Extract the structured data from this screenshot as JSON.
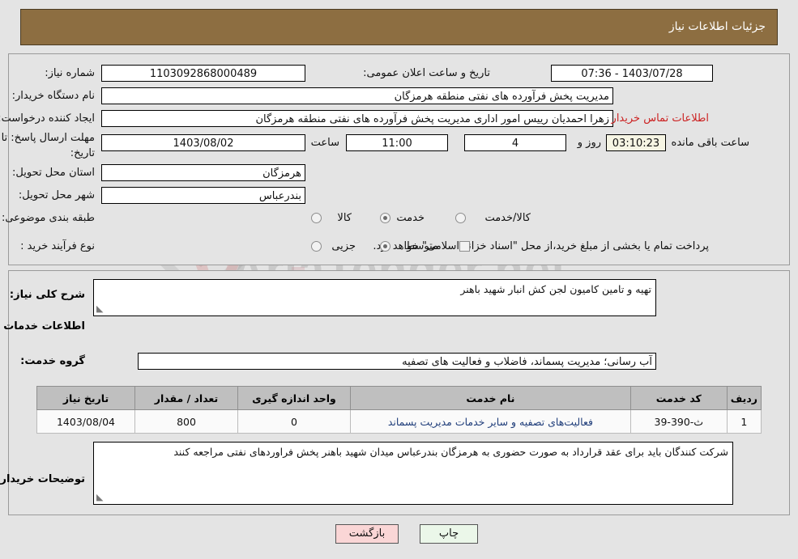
{
  "header": {
    "title": "جزئیات اطلاعات نیاز"
  },
  "watermark": {
    "text": "AriaTender.net",
    "letter": "V"
  },
  "top_form": {
    "need_number_label": "شماره نیاز:",
    "need_number_value": "1103092868000489",
    "buyer_org_label": "نام دستگاه خریدار:",
    "buyer_org_value": "مدیریت پخش فرآورده های نفتی منطقه هرمزگان",
    "creator_label": "ایجاد کننده درخواست:",
    "creator_value": "زهرا احمدیان رییس امور اداری مدیریت پخش فرآورده های نفتی منطقه هرمزگان",
    "buyer_contact_link": "اطلاعات تماس خریدار",
    "public_announce_label": "تاریخ و ساعت اعلان عمومی:",
    "public_announce_value": "1403/07/28 - 07:36",
    "deadline_label_line1": "مهلت ارسال پاسخ: تا",
    "deadline_label_line2": "تاریخ:",
    "deadline_date_value": "1403/08/02",
    "deadline_hour_label": "ساعت",
    "deadline_hour_value": "11:00",
    "remaining_days_value": "4",
    "remaining_days_label": "روز و",
    "remaining_time_value": "03:10:23",
    "remaining_time_label": "ساعت باقی مانده",
    "province_label": "استان محل تحویل:",
    "province_value": "هرمزگان",
    "city_label": "شهر محل تحویل:",
    "city_value": "بندرعباس",
    "category_label": "طبقه بندی موضوعی:",
    "category_options": [
      {
        "label": "کالا",
        "selected": false
      },
      {
        "label": "خدمت",
        "selected": true
      },
      {
        "label": "کالا/خدمت",
        "selected": false
      }
    ],
    "process_label": "نوع فرآیند خرید :",
    "process_options": [
      {
        "label": "جزیی",
        "selected": false
      },
      {
        "label": "متوسط",
        "selected": true
      }
    ],
    "treasury_checkbox_label": "پرداخت تمام یا بخشی از مبلغ خرید،از محل \"اسناد خزانه اسلامی\" خواهد بود.",
    "treasury_checked": false
  },
  "lower": {
    "general_desc_label": "شرح کلی نیاز:",
    "general_desc_value": "تهیه و تامین کامیون لجن کش انبار شهید باهنر",
    "services_section_title": "اطلاعات خدمات مورد نیاز",
    "service_group_label": "گروه خدمت:",
    "service_group_value": "آب رسانی؛ مدیریت پسماند، فاضلاب و فعالیت های تصفیه",
    "buyer_notes_label": "توضیحات خریدار:",
    "buyer_notes_value": "شرکت کنندگان باید برای عقد قرارداد  به  صورت   حضوری به هرمزگان بندرعباس میدان شهید باهنر پخش فراوردهای نفتی مراجعه کنند"
  },
  "table": {
    "columns": [
      "ردیف",
      "کد خدمت",
      "نام خدمت",
      "واحد اندازه گیری",
      "تعداد / مقدار",
      "تاریخ نیاز"
    ],
    "rows": [
      {
        "row_no": "1",
        "service_code": "ث-390-39",
        "service_name": "فعالیت‌های تصفیه و سایر خدمات مدیریت پسماند",
        "unit": "0",
        "quantity": "800",
        "need_date": "1403/08/04"
      }
    ]
  },
  "buttons": {
    "print": "چاپ",
    "back": "بازگشت"
  },
  "colors": {
    "header_brown": "#8d6e41",
    "page_bg": "#e4e4e4",
    "link_red": "#cc2222",
    "table_header": "#bfbfbf",
    "print_btn": "#ebf7e9",
    "back_btn": "#fad6d6",
    "countdown_bg": "#f6f5e4"
  }
}
